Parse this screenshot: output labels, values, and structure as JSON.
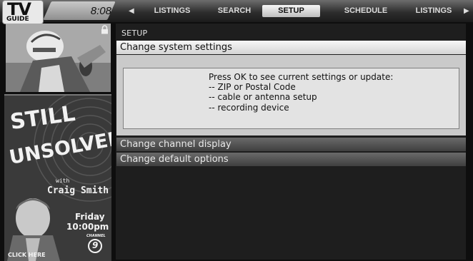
{
  "logo": {
    "line1": "TV",
    "line2": "GUIDE"
  },
  "clock": "8:08",
  "nav": {
    "tabs": [
      {
        "label": "LISTINGS"
      },
      {
        "label": "SEARCH"
      },
      {
        "label": "SETUP",
        "active": true
      },
      {
        "label": "SCHEDULE"
      },
      {
        "label": "LISTINGS"
      }
    ]
  },
  "main": {
    "section": "SETUP",
    "items": [
      {
        "label": "Change system settings",
        "selected": true
      },
      {
        "label": "Change channel display"
      },
      {
        "label": "Change default options"
      }
    ],
    "info": {
      "intro": "Press OK to see current settings or update:",
      "bullets": [
        "-- ZIP or Postal Code",
        "-- cable or antenna setup",
        "-- recording device"
      ]
    }
  },
  "promo": {
    "title1": "STILL",
    "title2": "UNSOLVED",
    "with": "with",
    "host": "Craig Smith",
    "day": "Friday",
    "time": "10:00pm",
    "channel_label": "CHANNEL",
    "channel": "9",
    "cta": "CLICK HERE"
  },
  "icons": [
    "lock-icon",
    "left-arrow-icon",
    "right-arrow-icon"
  ]
}
